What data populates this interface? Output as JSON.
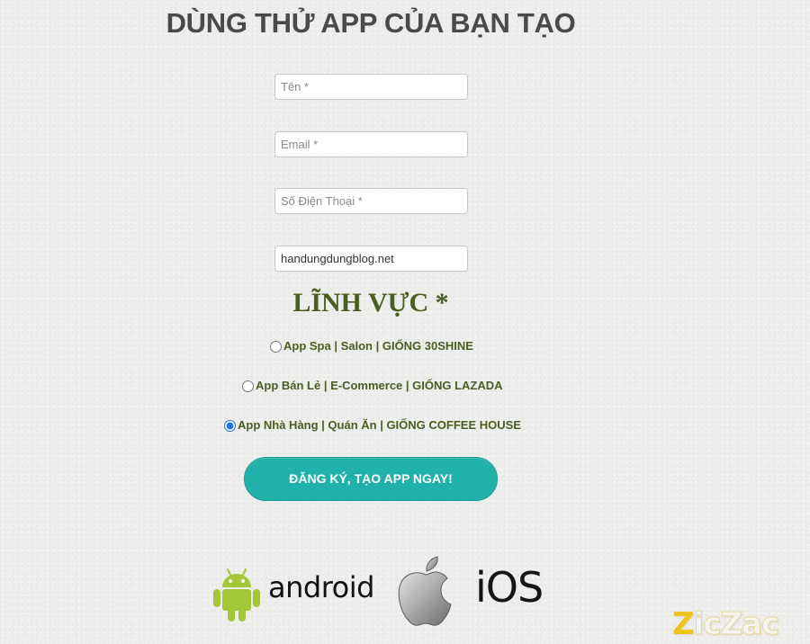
{
  "page": {
    "title": "DÙNG THỬ APP CỦA BẠN TẠO"
  },
  "form": {
    "name_placeholder": "Tên *",
    "email_placeholder": "Email *",
    "phone_placeholder": "Số Điện Thoại *",
    "website_value": "handungdungblog.net"
  },
  "field_section": {
    "title": "LĨNH VỰC *",
    "options": [
      {
        "label": "App Spa | Salon | GIỐNG 30SHINE",
        "selected": false
      },
      {
        "label": "App Bán Lẻ | E-Commerce | GIỐNG LAZADA",
        "selected": false
      },
      {
        "label": "App Nhà Hàng | Quán Ăn | GIỐNG COFFEE HOUSE",
        "selected": true
      }
    ]
  },
  "submit": {
    "label": "ĐĂNG KÝ, TẠO APP NGAY!"
  },
  "platforms": {
    "android_label": "android",
    "ios_label": "iOS",
    "android_color": "#a4c639",
    "apple_color": "#9a9a9a"
  },
  "watermark": {
    "first": "Z",
    "rest": "icZac"
  },
  "colors": {
    "accent": "#20b2aa",
    "section_text": "#4a5e22",
    "title_text": "#4a4a4a"
  }
}
